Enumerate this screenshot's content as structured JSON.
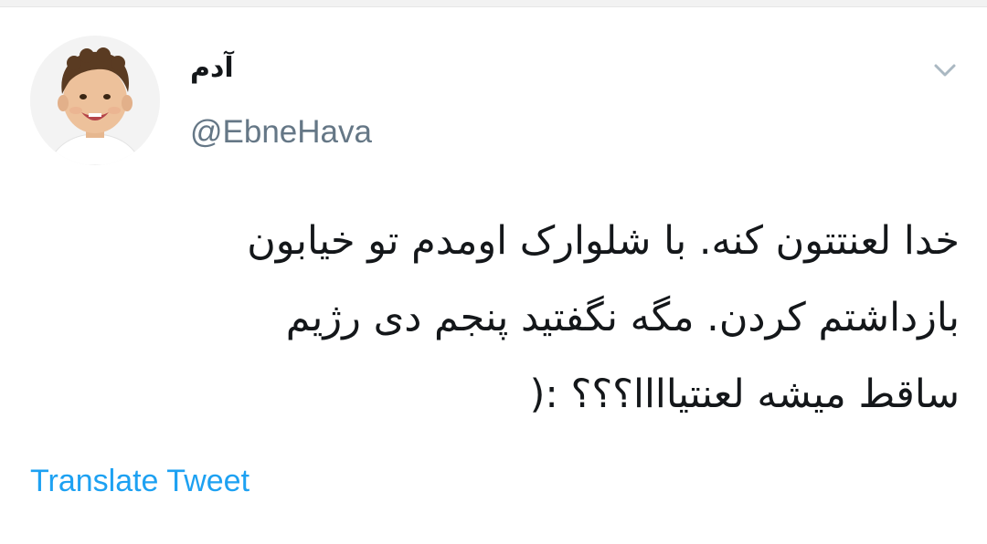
{
  "tweet": {
    "author": {
      "display_name": "آدم",
      "handle": "@EbneHava",
      "avatar_icon": "avatar-photo"
    },
    "menu_icon": "chevron-down-icon",
    "text_lines": [
      "خدا لعنتتون کنه. با شلوارک اومدم تو خیابون",
      "بازداشتم کردن. مگه نگفتید پنجم دی رژیم",
      "ساقط میشه لعنتیاااا؟؟؟ :("
    ],
    "translate_label": "Translate Tweet"
  },
  "colors": {
    "text": "#14171a",
    "secondary": "#657786",
    "link": "#1da1f2",
    "chevron": "#aab8c2"
  }
}
